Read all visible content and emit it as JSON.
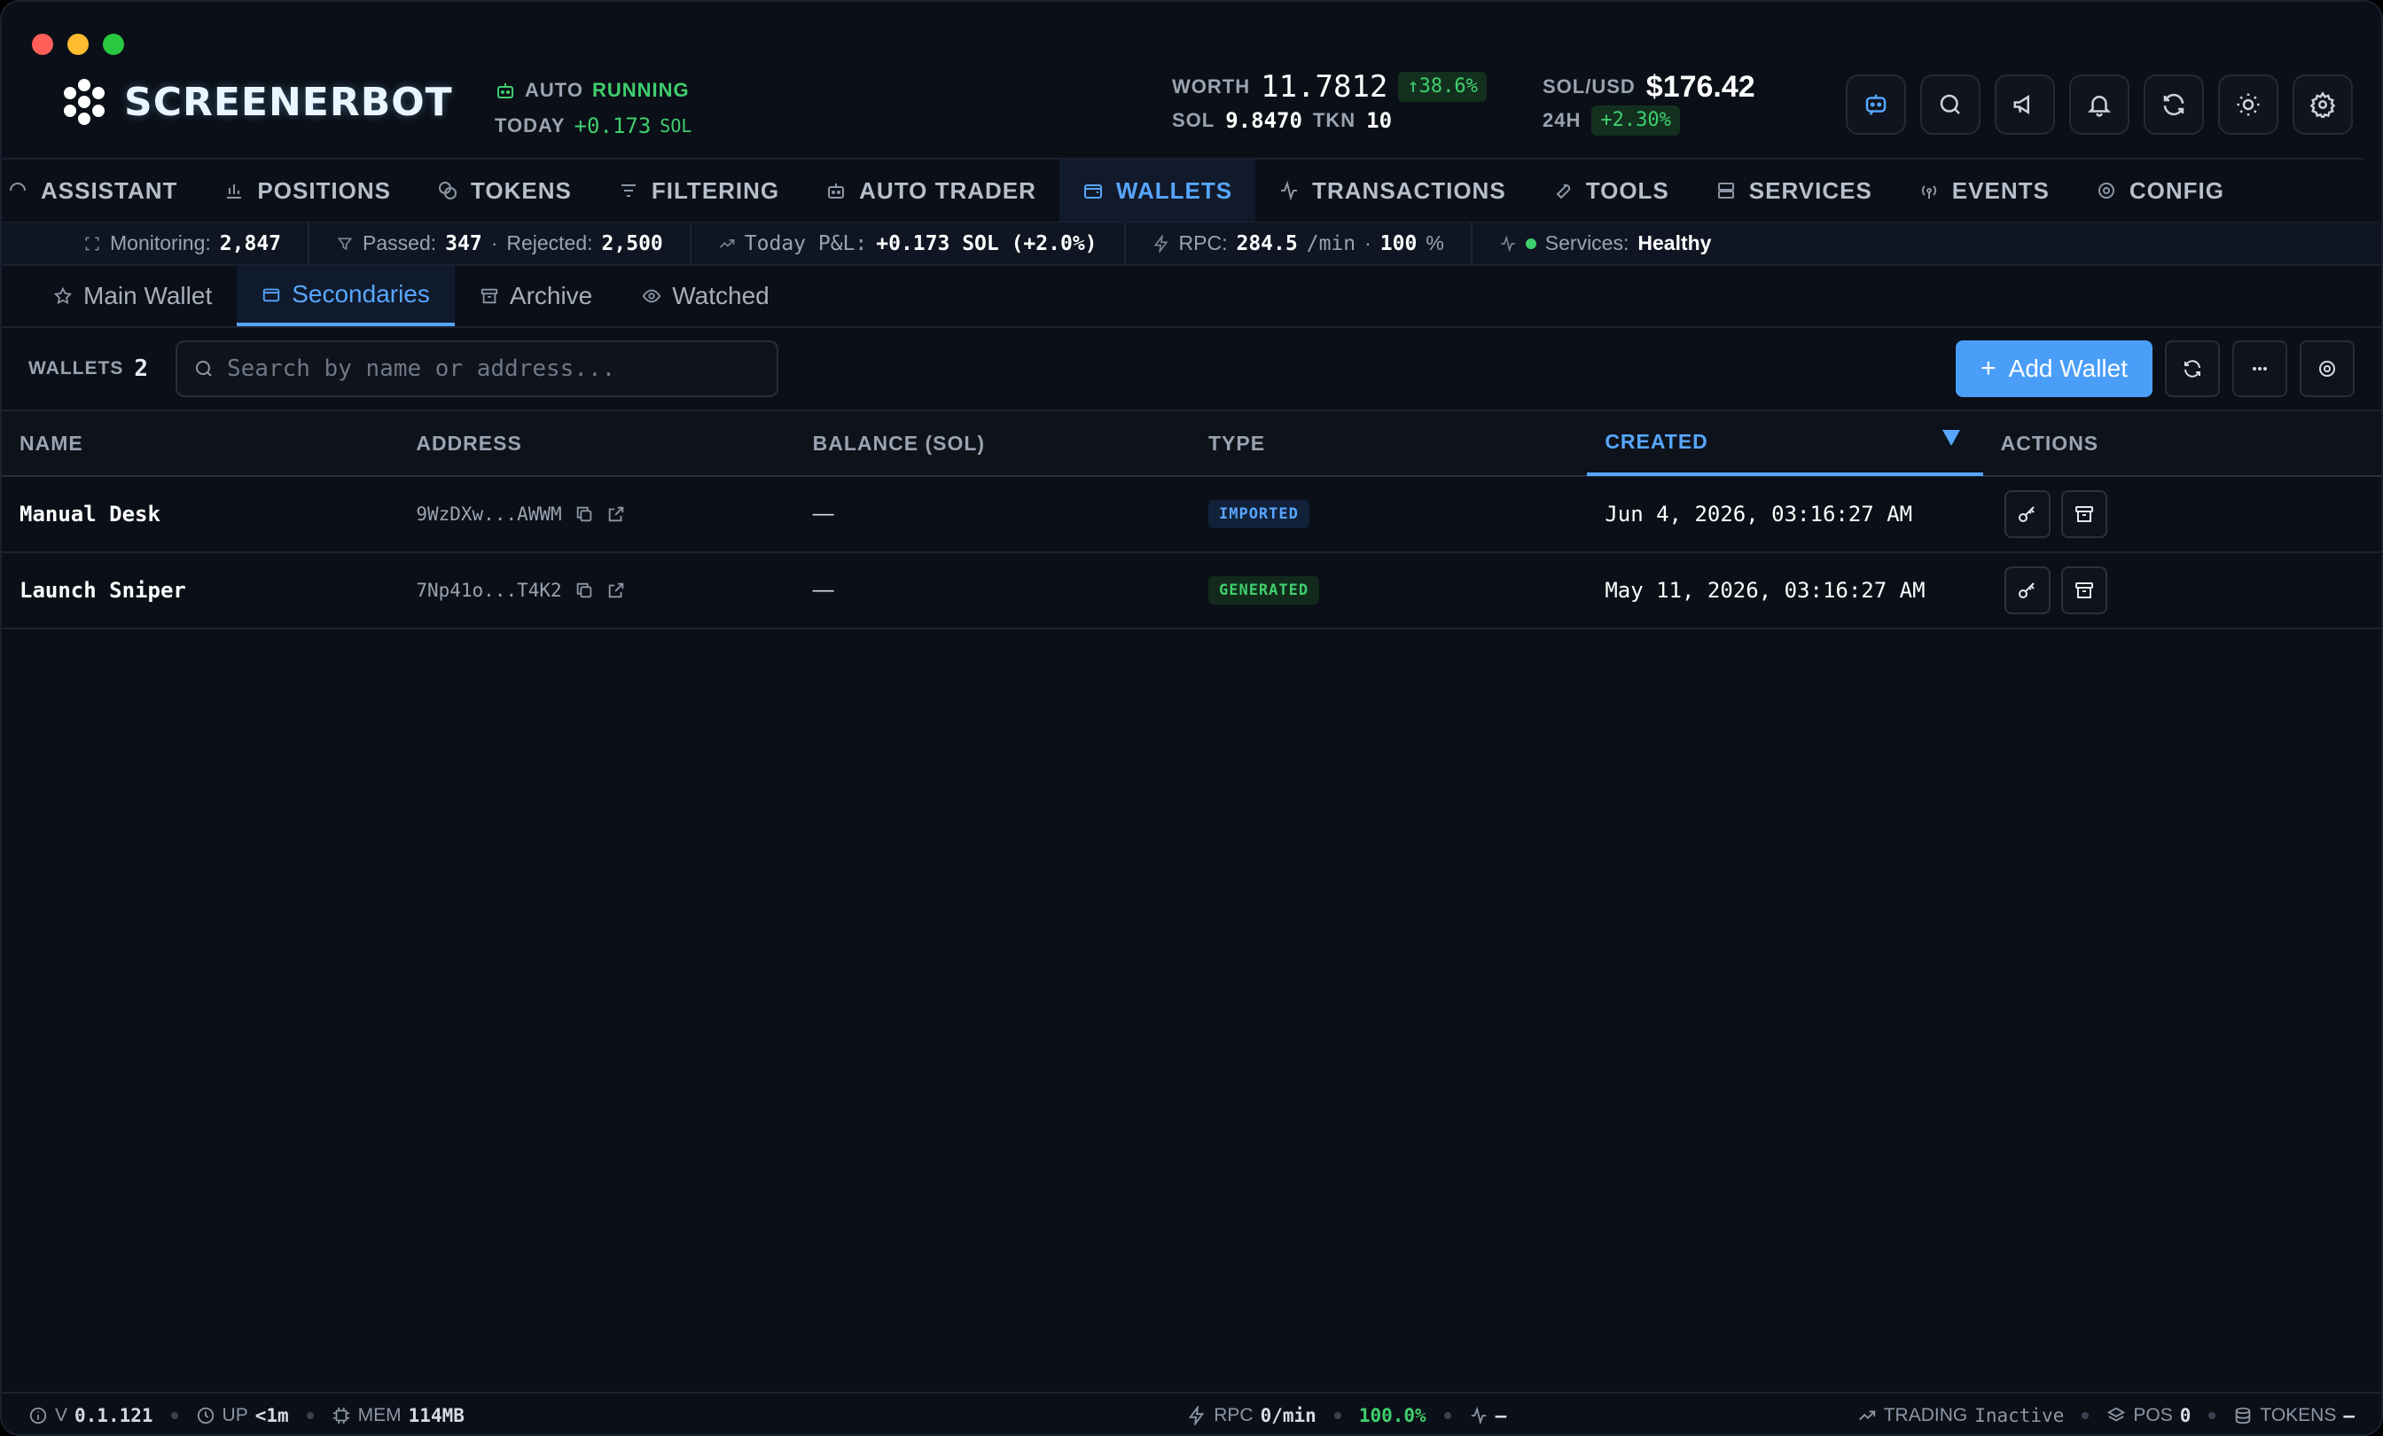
{
  "header": {
    "brand": "SCREENERBOT",
    "auto_label": "AUTO",
    "auto_status": "RUNNING",
    "today_label": "TODAY",
    "today_value": "+0.173",
    "today_unit": "SOL",
    "worth_label": "WORTH",
    "worth_value": "11.7812",
    "worth_change": "↑38.6%",
    "sol_label": "SOL",
    "sol_value": "9.8470",
    "tkn_label": "TKN",
    "tkn_value": "10",
    "solusd_label": "SOL/USD",
    "solusd_value": "$176.42",
    "h24_label": "24H",
    "h24_change": "+2.30%"
  },
  "nav": {
    "items": [
      {
        "label": "ASSISTANT",
        "icon": "assistant-icon"
      },
      {
        "label": "POSITIONS",
        "icon": "chart-bar-icon"
      },
      {
        "label": "TOKENS",
        "icon": "coins-icon"
      },
      {
        "label": "FILTERING",
        "icon": "filter-icon"
      },
      {
        "label": "AUTO TRADER",
        "icon": "robot-icon"
      },
      {
        "label": "WALLETS",
        "icon": "wallet-icon"
      },
      {
        "label": "TRANSACTIONS",
        "icon": "activity-icon"
      },
      {
        "label": "TOOLS",
        "icon": "wrench-icon"
      },
      {
        "label": "SERVICES",
        "icon": "server-icon"
      },
      {
        "label": "EVENTS",
        "icon": "radio-icon"
      },
      {
        "label": "CONFIG",
        "icon": "gear-icon"
      }
    ],
    "active": "WALLETS"
  },
  "ticker": {
    "monitoring_label": "Monitoring:",
    "monitoring_value": "2,847",
    "passed_label": "Passed:",
    "passed_value": "347",
    "rejected_label": "Rejected:",
    "rejected_value": "2,500",
    "pnl_label": "Today P&L:",
    "pnl_value": "+0.173 SOL (+2.0%)",
    "rpc_label": "RPC:",
    "rpc_value": "284.5",
    "rpc_unit": "/min",
    "rpc_pct": "100",
    "rpc_pct_unit": "%",
    "services_label": "Services:",
    "services_value": "Healthy"
  },
  "subtabs": {
    "main": "Main Wallet",
    "secondaries": "Secondaries",
    "archive": "Archive",
    "watched": "Watched"
  },
  "toolbar": {
    "wallets_label": "WALLETS",
    "wallets_count": "2",
    "search_placeholder": "Search by name or address...",
    "add_label": "Add Wallet",
    "add_plus": "+"
  },
  "table": {
    "columns": {
      "name": "NAME",
      "address": "ADDRESS",
      "balance": "BALANCE (SOL)",
      "type": "TYPE",
      "created": "CREATED",
      "actions": "ACTIONS"
    },
    "rows": [
      {
        "name": "Manual Desk",
        "address": "9WzDXw...AWWM",
        "balance": "—",
        "type": "IMPORTED",
        "created": "Jun 4, 2026, 03:16:27 AM"
      },
      {
        "name": "Launch Sniper",
        "address": "7Np41o...T4K2",
        "balance": "—",
        "type": "GENERATED",
        "created": "May 11, 2026, 03:16:27 AM"
      }
    ]
  },
  "footer": {
    "version_label": "V",
    "version_value": "0.1.121",
    "up_label": "UP",
    "up_value": "<1m",
    "mem_label": "MEM",
    "mem_value": "114MB",
    "rpc_label": "RPC",
    "rpc_value": "0/min",
    "success_value": "100.0%",
    "pulse_value": "—",
    "trading_label": "TRADING",
    "trading_value": "Inactive",
    "pos_label": "POS",
    "pos_value": "0",
    "tokens_label": "TOKENS",
    "tokens_value": "—"
  },
  "colors": {
    "accent": "#58a6ff",
    "positive": "#3fcf6e",
    "background": "#0b0f17"
  }
}
